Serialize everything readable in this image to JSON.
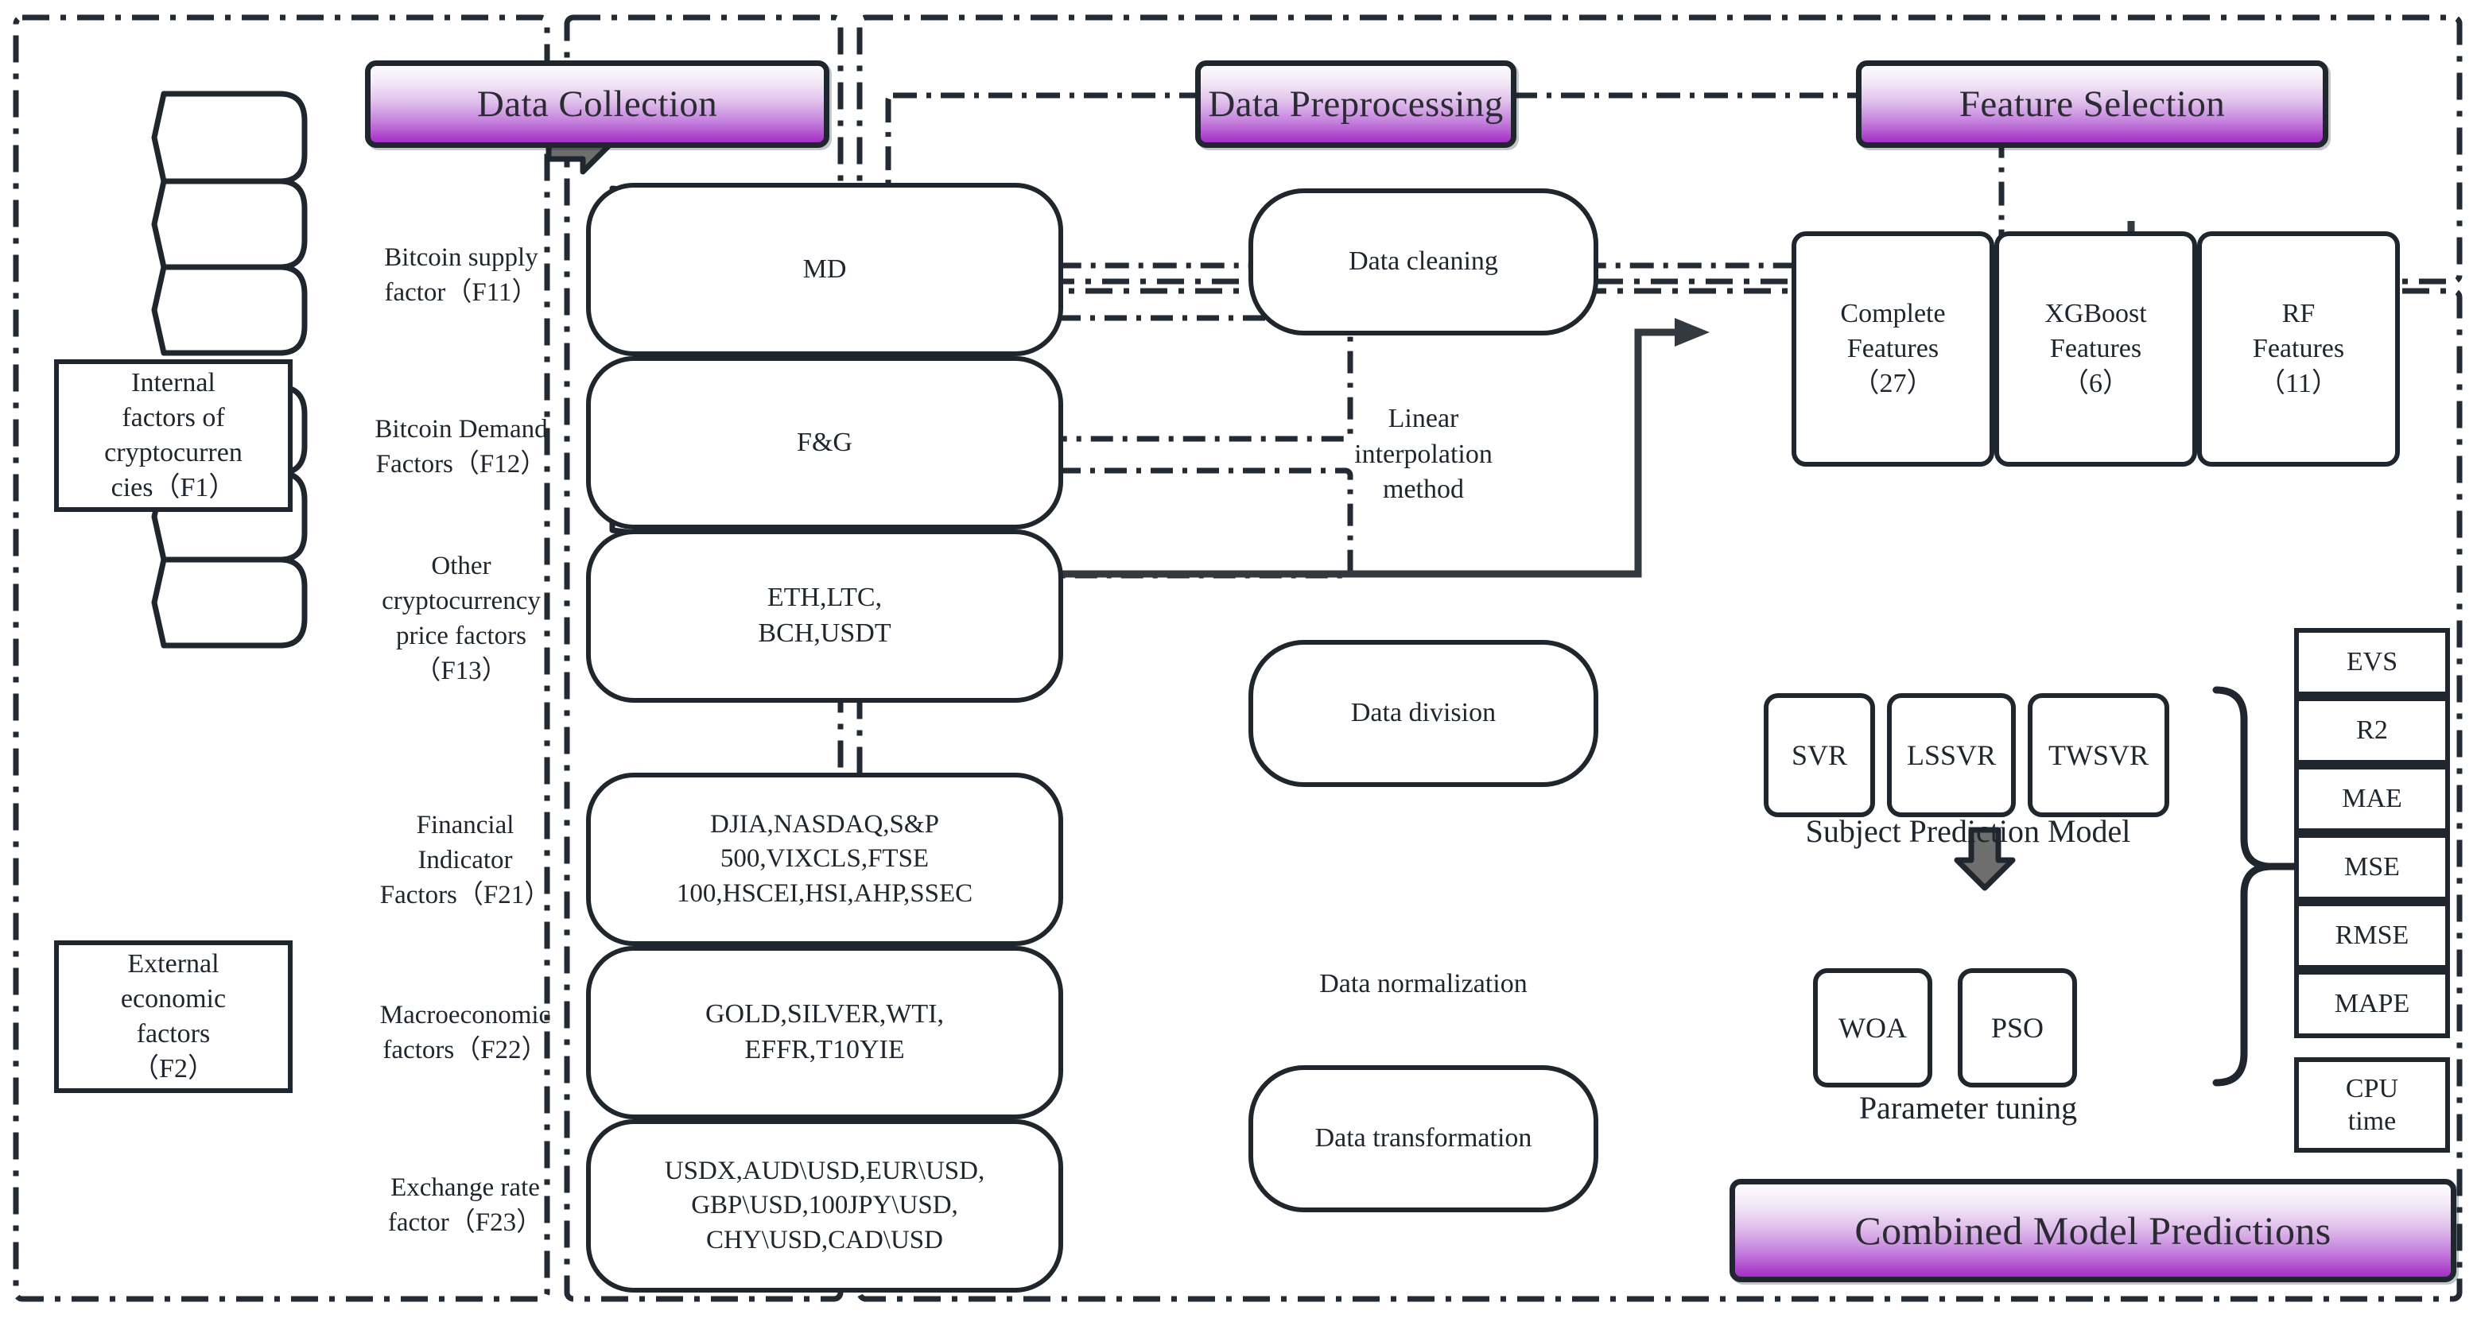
{
  "diagram": {
    "panels": [
      {
        "id": "data-collection",
        "title": "Data Collection"
      },
      {
        "id": "data-preprocessing",
        "title": "Data Preprocessing"
      },
      {
        "id": "feature-selection",
        "title": "Feature Selection"
      }
    ]
  },
  "data_collection": {
    "title": "Data Collection",
    "groups": [
      {
        "group_label": "Internal\nfactors of\ncryptocurren\ncies（F1）",
        "group_label_lines": [
          "Internal",
          "factors of",
          "cryptocurren",
          "cies（F1）"
        ],
        "factors": [
          {
            "name_lines": [
              "Bitcoin supply",
              "factor（F11）"
            ],
            "name": "Bitcoin supply factor（F11）",
            "data": "MD",
            "data_lines": [
              "MD"
            ]
          },
          {
            "name_lines": [
              "Bitcoin Demand",
              "Factors（F12）"
            ],
            "name": "Bitcoin Demand Factors（F12）",
            "data": "F&G",
            "data_lines": [
              "F&G"
            ]
          },
          {
            "name_lines": [
              "Other",
              "cryptocurrency",
              "price factors",
              "（F13）"
            ],
            "name": "Other cryptocurrency price factors（F13）",
            "data": "ETH,LTC, BCH,USDT",
            "data_lines": [
              "ETH,LTC,",
              "BCH,USDT"
            ]
          }
        ]
      },
      {
        "group_label": "External\neconomic\nfactors\n（F2）",
        "group_label_lines": [
          "External",
          "economic",
          "factors",
          "（F2）"
        ],
        "factors": [
          {
            "name_lines": [
              "Financial",
              "Indicator",
              "Factors（F21）"
            ],
            "name": "Financial Indicator Factors（F21）",
            "data": "DJIA,NASDAQ,S&P 500,VIXCLS,FTSE 100,HSCEI,HSI,AHP,SSEC",
            "data_lines": [
              "DJIA,NASDAQ,S&P",
              "500,VIXCLS,FTSE",
              "100,HSCEI,HSI,AHP,SSEC"
            ]
          },
          {
            "name_lines": [
              "Macroeconomic",
              "factors（F22）"
            ],
            "name": "Macroeconomic factors（F22）",
            "data": "GOLD,SILVER,WTI, EFFR,T10YIE",
            "data_lines": [
              "GOLD,SILVER,WTI,",
              "EFFR,T10YIE"
            ]
          },
          {
            "name_lines": [
              "Exchange rate",
              "factor（F23）"
            ],
            "name": "Exchange rate factor（F23）",
            "data": "USDX,AUD\\USD,EUR\\USD, GBP\\USD,100JPY\\USD, CHY\\USD,CAD\\USD",
            "data_lines": [
              "USDX,AUD\\USD,EUR\\USD,",
              "GBP\\USD,100JPY\\USD,",
              "CHY\\USD,CAD\\USD"
            ]
          }
        ]
      }
    ]
  },
  "data_preprocessing": {
    "title": "Data Preprocessing",
    "steps": [
      {
        "label": "Data cleaning",
        "shape": "rounded"
      },
      {
        "label": "Linear interpolation method",
        "label_lines": [
          "Linear",
          "interpolation",
          "method"
        ],
        "shape": "cylinder"
      },
      {
        "label": "Data division",
        "shape": "rounded"
      },
      {
        "label": "Data normalization",
        "shape": "cylinder"
      },
      {
        "label": "Data transformation",
        "shape": "rounded"
      }
    ]
  },
  "feature_selection": {
    "title": "Feature Selection",
    "features": [
      {
        "name_lines": [
          "Complete",
          "Features",
          "（27）"
        ],
        "name": "Complete Features（27）",
        "count": "27"
      },
      {
        "name_lines": [
          "XGBoost",
          "Features",
          "（6）"
        ],
        "name": "XGBoost Features（6）",
        "count": "6"
      },
      {
        "name_lines": [
          "RF",
          "Features",
          "（11）"
        ],
        "name": "RF Features（11）",
        "count": "11"
      }
    ]
  },
  "modeling": {
    "subject_prediction_model": {
      "caption": "Subject Prediction Model",
      "models": [
        "SVR",
        "LSSVR",
        "TWSVR"
      ]
    },
    "parameter_tuning": {
      "caption": "Parameter tuning",
      "optimizers": [
        "WOA",
        "PSO"
      ]
    },
    "metrics": [
      "EVS",
      "R2",
      "MAE",
      "MSE",
      "RMSE",
      "MAPE"
    ],
    "extra_metric_lines": [
      "CPU",
      "time"
    ],
    "extra_metric": "CPU time",
    "final_banner": "Combined Model Predictions"
  },
  "colors": {
    "outline": "#20262e",
    "banner_top": "#fdfbfe",
    "banner_bottom": "#a42fc4",
    "arrow_fill": "#6e6e6e",
    "arrow_stroke": "#20262e",
    "page_background": "#ffffff"
  }
}
